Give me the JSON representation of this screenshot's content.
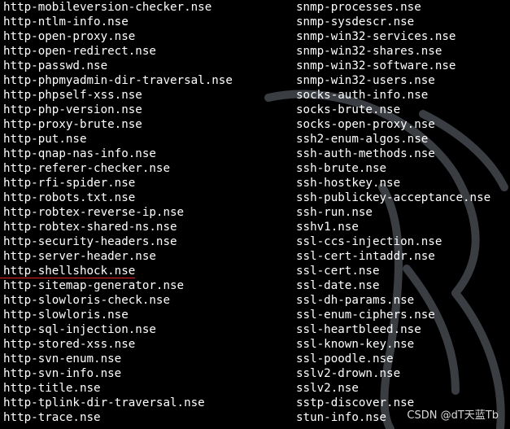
{
  "colors": {
    "background": "#000000",
    "text": "#ffffff",
    "underline": "#e02020",
    "logo_stroke": "#3a3d42"
  },
  "background_logo": "kali-dragon-watermark",
  "highlighted_entry": "http-shellshock.nse",
  "left_column": [
    "http-mobileversion-checker.nse",
    "http-ntlm-info.nse",
    "http-open-proxy.nse",
    "http-open-redirect.nse",
    "http-passwd.nse",
    "http-phpmyadmin-dir-traversal.nse",
    "http-phpself-xss.nse",
    "http-php-version.nse",
    "http-proxy-brute.nse",
    "http-put.nse",
    "http-qnap-nas-info.nse",
    "http-referer-checker.nse",
    "http-rfi-spider.nse",
    "http-robots.txt.nse",
    "http-robtex-reverse-ip.nse",
    "http-robtex-shared-ns.nse",
    "http-security-headers.nse",
    "http-server-header.nse",
    "http-shellshock.nse",
    "http-sitemap-generator.nse",
    "http-slowloris-check.nse",
    "http-slowloris.nse",
    "http-sql-injection.nse",
    "http-stored-xss.nse",
    "http-svn-enum.nse",
    "http-svn-info.nse",
    "http-title.nse",
    "http-tplink-dir-traversal.nse",
    "http-trace.nse"
  ],
  "right_column": [
    "snmp-processes.nse",
    "snmp-sysdescr.nse",
    "snmp-win32-services.nse",
    "snmp-win32-shares.nse",
    "snmp-win32-software.nse",
    "snmp-win32-users.nse",
    "socks-auth-info.nse",
    "socks-brute.nse",
    "socks-open-proxy.nse",
    "ssh2-enum-algos.nse",
    "ssh-auth-methods.nse",
    "ssh-brute.nse",
    "ssh-hostkey.nse",
    "ssh-publickey-acceptance.nse",
    "ssh-run.nse",
    "sshv1.nse",
    "ssl-ccs-injection.nse",
    "ssl-cert-intaddr.nse",
    "ssl-cert.nse",
    "ssl-date.nse",
    "ssl-dh-params.nse",
    "ssl-enum-ciphers.nse",
    "ssl-heartbleed.nse",
    "ssl-known-key.nse",
    "ssl-poodle.nse",
    "sslv2-drown.nse",
    "sslv2.nse",
    "sstp-discover.nse",
    "stun-info.nse"
  ],
  "watermark": "CSDN @dT天蓝Tb"
}
